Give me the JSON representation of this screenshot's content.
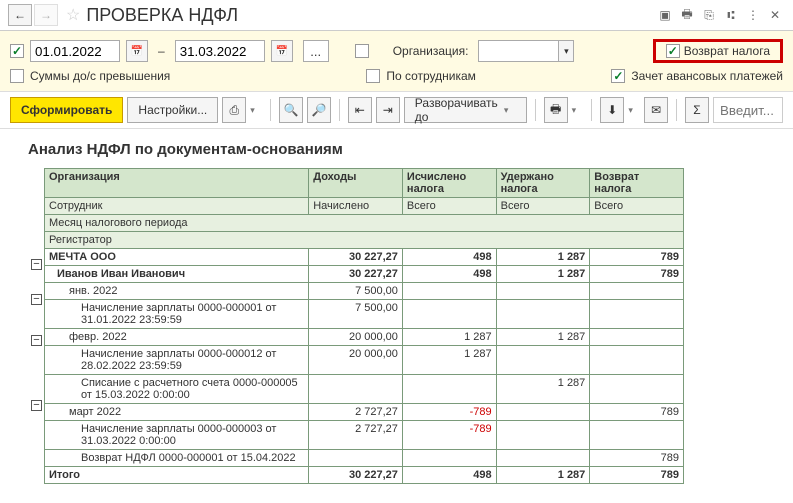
{
  "title": "ПРОВЕРКА НДФЛ",
  "filters": {
    "date_from": "01.01.2022",
    "date_to": "31.03.2022",
    "org_label": "Организация:",
    "org_value": "",
    "return_tax": "Возврат налога",
    "sums_prepay": "Суммы до/с превышения",
    "by_employees": "По сотрудникам",
    "advance_credit": "Зачет авансовых платежей"
  },
  "toolbar": {
    "form": "Сформировать",
    "settings": "Настройки...",
    "expand": "Разворачивать до",
    "find_ph": "Введит..."
  },
  "report": {
    "title": "Анализ НДФЛ по документам-основаниям",
    "headers": {
      "org": "Организация",
      "inc": "Доходы",
      "calc": "Исчислено налога",
      "held": "Удержано налога",
      "ret": "Возврат налога",
      "emp": "Сотрудник",
      "accr": "Начислено",
      "total": "Всего",
      "month": "Месяц налогового периода",
      "reg": "Регистратор"
    },
    "rows": [
      {
        "lvl": 0,
        "b": 1,
        "c0": "МЕЧТА ООО",
        "c1": "30 227,27",
        "c2": "498",
        "c3": "1 287",
        "c4": "789"
      },
      {
        "lvl": 1,
        "b": 1,
        "c0": "Иванов Иван Иванович",
        "c1": "30 227,27",
        "c2": "498",
        "c3": "1 287",
        "c4": "789"
      },
      {
        "lvl": 2,
        "c0": "янв. 2022",
        "c1": "7 500,00",
        "c2": "",
        "c3": "",
        "c4": ""
      },
      {
        "lvl": 3,
        "c0": "Начисление зарплаты 0000-000001 от 31.01.2022 23:59:59",
        "c1": "7 500,00",
        "c2": "",
        "c3": "",
        "c4": ""
      },
      {
        "lvl": 2,
        "c0": "февр. 2022",
        "c1": "20 000,00",
        "c2": "1 287",
        "c3": "1 287",
        "c4": ""
      },
      {
        "lvl": 3,
        "c0": "Начисление зарплаты 0000-000012 от 28.02.2022 23:59:59",
        "c1": "20 000,00",
        "c2": "1 287",
        "c3": "",
        "c4": ""
      },
      {
        "lvl": 3,
        "c0": "Списание с расчетного счета 0000-000005 от 15.03.2022 0:00:00",
        "c1": "",
        "c2": "",
        "c3": "1 287",
        "c4": ""
      },
      {
        "lvl": 2,
        "c0": "март 2022",
        "c1": "2 727,27",
        "c2": "-789",
        "c3": "",
        "c4": "789"
      },
      {
        "lvl": 3,
        "c0": "Начисление зарплаты 0000-000003 от 31.03.2022 0:00:00",
        "c1": "2 727,27",
        "c2": "-789",
        "c3": "",
        "c4": ""
      },
      {
        "lvl": 3,
        "c0": "Возврат НДФЛ 0000-000001 от 15.04.2022",
        "c1": "",
        "c2": "",
        "c3": "",
        "c4": "789"
      }
    ],
    "total": {
      "label": "Итого",
      "c1": "30 227,27",
      "c2": "498",
      "c3": "1 287",
      "c4": "789"
    }
  }
}
